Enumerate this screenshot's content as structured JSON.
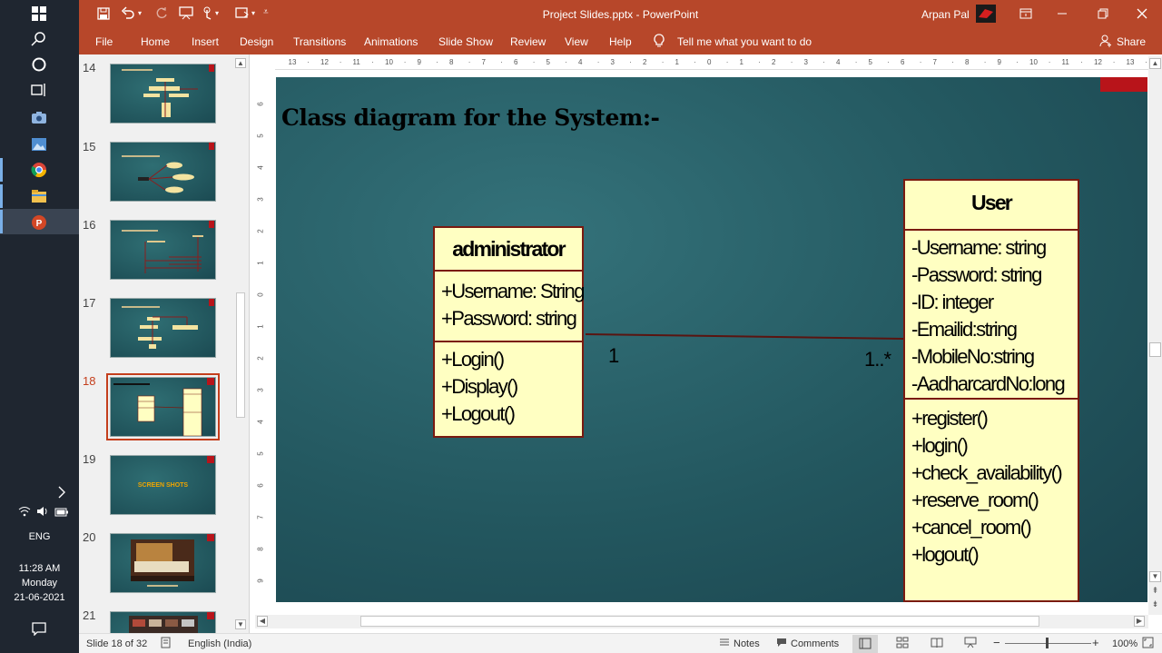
{
  "taskbar": {
    "time": "11:28 AM",
    "day": "Monday",
    "date": "21-06-2021",
    "language": "ENG",
    "icons": [
      "windows-start-icon",
      "search-icon",
      "cortana-icon",
      "task-view-icon",
      "camera-icon",
      "photos-icon",
      "chrome-icon",
      "file-explorer-icon",
      "powerpoint-icon"
    ]
  },
  "titlebar": {
    "title": "Project Slides.pptx  -  PowerPoint",
    "user": "Arpan Pal"
  },
  "ribbon": {
    "tabs": [
      "File",
      "Home",
      "Insert",
      "Design",
      "Transitions",
      "Animations",
      "Slide Show",
      "Review",
      "View",
      "Help"
    ],
    "tell_me": "Tell me what you want to do",
    "share": "Share"
  },
  "thumbnails": {
    "numbers": [
      "14",
      "15",
      "16",
      "17",
      "18",
      "19",
      "20",
      "21"
    ],
    "selected": "18",
    "slide19_text": "SCREEN SHOTS"
  },
  "slide": {
    "title": "Class diagram for the System:-",
    "admin": {
      "name": "administrator",
      "attributes": [
        "+Username: String",
        "+Password: string"
      ],
      "methods": [
        "+Login()",
        "+Display()",
        "+Logout()"
      ]
    },
    "user": {
      "name": "User",
      "attributes": [
        "-Username: string",
        "-Password: string",
        "-ID: integer",
        "-Emailid:string",
        "-MobileNo:string",
        "-AadharcardNo:long"
      ],
      "methods": [
        "+register()",
        "+login()",
        "+check_availability()",
        "+reserve_room()",
        "+cancel_room()",
        "+logout()"
      ]
    },
    "mult_left": "1",
    "mult_right": "1..*"
  },
  "status": {
    "slide_info": "Slide 18 of 32",
    "language": "English (India)",
    "notes": "Notes",
    "comments": "Comments",
    "zoom": "100%"
  },
  "colors": {
    "titlebar": "#b7472a",
    "uml_fill": "#ffffc2",
    "uml_border": "#7a1a10",
    "selected_thumb": "#c43e1c"
  }
}
